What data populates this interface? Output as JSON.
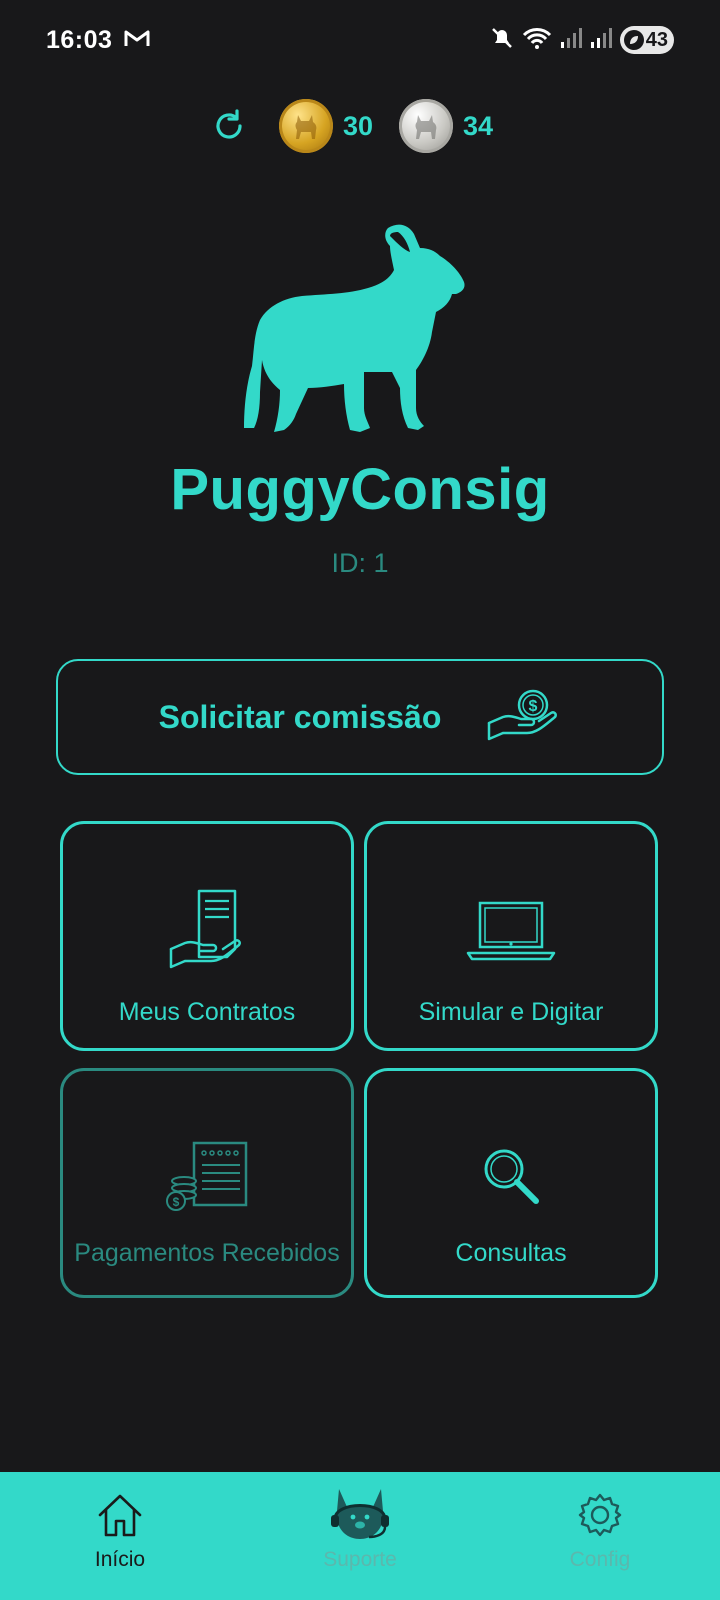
{
  "status_bar": {
    "time": "16:03",
    "battery": "43",
    "icons": [
      "gmail-icon",
      "mute-icon",
      "wifi-icon",
      "signal-icon",
      "signal-icon",
      "battery-saver-icon"
    ]
  },
  "coins": {
    "gold_count": "30",
    "silver_count": "34"
  },
  "app": {
    "name": "PuggyConsig",
    "user_id": "ID: 1"
  },
  "actions": {
    "commission_label": "Solicitar comissão",
    "cards": {
      "contracts": "Meus Contratos",
      "simulate": "Simular e Digitar",
      "payments": "Pagamentos Recebidos",
      "queries": "Consultas"
    }
  },
  "nav": {
    "home": "Início",
    "support": "Suporte",
    "config": "Config"
  },
  "colors": {
    "accent": "#33d9c9",
    "accent_dim": "#2a8a80",
    "background": "#18181a",
    "nav_background": "#33d9c9"
  }
}
